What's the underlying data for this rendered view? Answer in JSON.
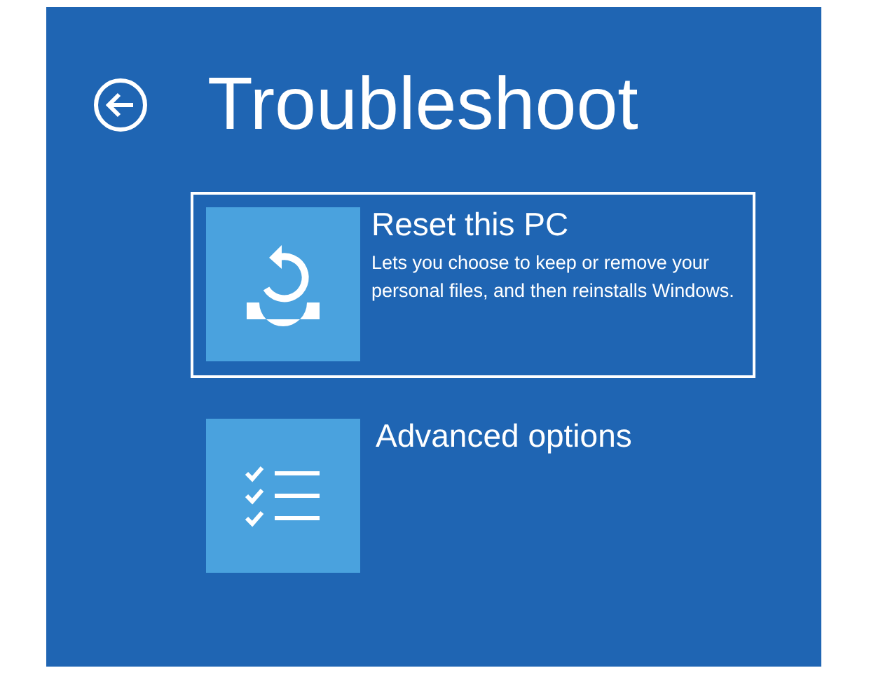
{
  "title": "Troubleshoot",
  "options": [
    {
      "kind": "reset",
      "title": "Reset this PC",
      "description": "Lets you choose to keep or remove your personal files, and then reinstalls Windows.",
      "selected": true
    },
    {
      "kind": "advanced",
      "title": "Advanced options",
      "selected": false
    }
  ]
}
